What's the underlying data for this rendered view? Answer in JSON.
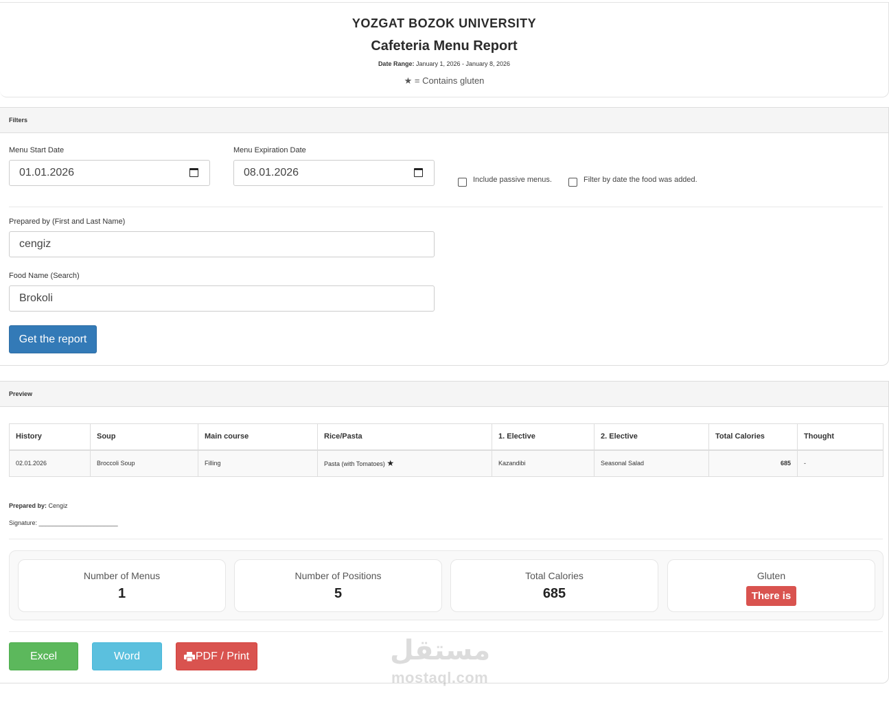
{
  "header": {
    "university": "YOZGAT BOZOK UNIVERSITY",
    "report_title": "Cafeteria Menu Report",
    "date_range_label": "Date Range:",
    "date_range_value": "January 1, 2026 - January 8, 2026",
    "gluten_legend": "★ = Contains gluten"
  },
  "filters": {
    "heading": "Filters",
    "start_date_label": "Menu Start Date",
    "start_date_value": "01.01.2026",
    "end_date_label": "Menu Expiration Date",
    "end_date_value": "08.01.2026",
    "passive_label": "Include passive menus.",
    "filter_added_label": "Filter by date the food was added.",
    "prepared_by_label": "Prepared by (First and Last Name)",
    "prepared_by_value": "cengiz",
    "food_name_label": "Food Name (Search)",
    "food_name_value": "Brokoli",
    "submit_label": "Get the report"
  },
  "preview": {
    "heading": "Preview",
    "columns": [
      "History",
      "Soup",
      "Main course",
      "Rice/Pasta",
      "1. Elective",
      "2. Elective",
      "Total Calories",
      "Thought"
    ],
    "rows": [
      {
        "history": "02.01.2026",
        "soup": "Broccoli Soup",
        "main": "Filling",
        "rice": "Pasta (with Tomatoes)",
        "rice_star": "★",
        "elective1": "Kazandibi",
        "elective2": "Seasonal Salad",
        "calories": "685",
        "thought": "-"
      }
    ],
    "prepared_by_label": "Prepared by:",
    "prepared_by_value": "Cengiz",
    "signature_label": "Signature:",
    "signature_line": "_______________________"
  },
  "stats": {
    "menus_label": "Number of Menus",
    "menus_value": "1",
    "positions_label": "Number of Positions",
    "positions_value": "5",
    "calories_label": "Total Calories",
    "calories_value": "685",
    "gluten_label": "Gluten",
    "gluten_value": "There is"
  },
  "exports": {
    "excel": "Excel",
    "word": "Word",
    "pdf": "PDF / Print"
  },
  "watermark": {
    "arabic": "مستقل",
    "latin": "mostaql.com"
  },
  "colors": {
    "primary": "#337ab7",
    "excel": "#5cb85c",
    "word": "#5bc0de",
    "pdf": "#d9534f"
  }
}
